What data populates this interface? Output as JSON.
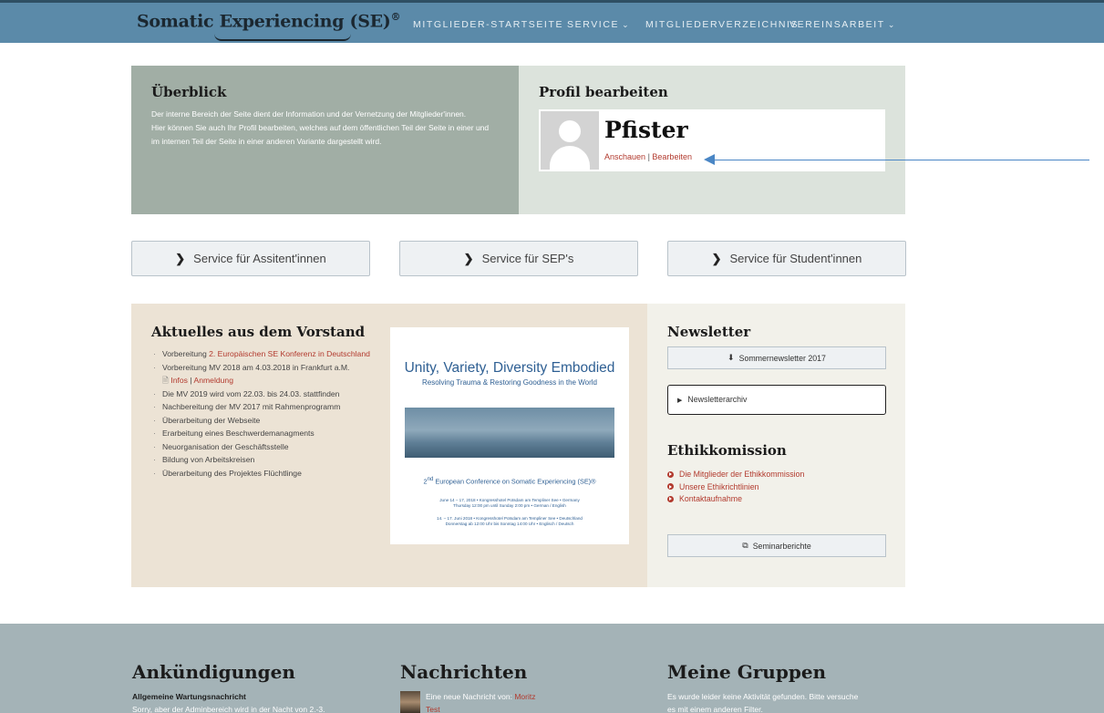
{
  "header": {
    "logo": "Somatic Experiencing (SE)",
    "logo_reg": "®",
    "nav": [
      {
        "label": "MITGLIEDER-STARTSEITE",
        "has_dropdown": false
      },
      {
        "label": "SERVICE",
        "has_dropdown": true
      },
      {
        "label": "MITGLIEDERVERZEICHNIS",
        "has_dropdown": false
      },
      {
        "label": "VEREINSARBEIT",
        "has_dropdown": true
      }
    ],
    "colors": {
      "bar": "#5b8aa9",
      "accent_red": "#b23a2e"
    }
  },
  "overview": {
    "title": "Überblick",
    "text1": "Der interne Bereich der Seite dient der Information und der Vernetzung der Mitglieder'innen.",
    "text2": "Hier können Sie auch Ihr Profil bearbeiten, welches auf dem öffentlichen Teil der Seite in einer und im internen Teil der Seite in einer anderen Variante dargestellt wird."
  },
  "profile": {
    "title": "Profil bearbeiten",
    "name": "Pfister",
    "view_link": "Anschauen",
    "separator": "|",
    "edit_link": "Bearbeiten"
  },
  "services": [
    "Service für Assitent'innen",
    "Service für SEP's",
    "Service für Student'innen"
  ],
  "board": {
    "title": "Aktuelles aus dem Vorstand",
    "item1_prefix": "Vorbereitung ",
    "item1_link": "2. Europäischen SE Konferenz in Deutschland",
    "item2": "Vorbereitung MV 2018 am 4.03.2018 in Frankfurt a.M.",
    "item2_link_infos": "Infos",
    "item2_sep": "|",
    "item2_link_anmeldung": "Anmeldung",
    "items": [
      "Die MV 2019 wird vom 22.03. bis 24.03. stattfinden",
      "Nachbereitung der MV 2017 mit Rahmenprogramm",
      "Überarbeitung der Webseite",
      "Erarbeitung eines Beschwerdemanagments",
      "Neuorganisation der Geschäftsstelle",
      "Bildung von Arbeitskreisen",
      "Überarbeitung des Projektes Flüchtlinge"
    ]
  },
  "poster": {
    "title": "Unity, Variety, Diversity Embodied",
    "subtitle": "Resolving Trauma & Restoring Goodness in the World",
    "conference_prefix": "2",
    "conference_sup": "nd",
    "conference_rest": " European Conference on Somatic Experiencing (SE)®",
    "dates_en_1": "June 14 – 17, 2018 • Kongresshotel Potsdam am Templiner See • Germany",
    "dates_en_2": "Thursday 12:00 pm until Sunday 2:00 pm • German / English",
    "dates_de_1": "14. – 17. Juni 2018 • Kongresshotel Potsdam am Templiner See • Deutschland",
    "dates_de_2": "Donnerstag ab 12:00 Uhr bis Sonntag 14:00 Uhr • Englisch / Deutsch"
  },
  "newsletter": {
    "title": "Newsletter",
    "download_label": "Sommernewsletter 2017",
    "archive_label": "Newsletterarchiv"
  },
  "ethics": {
    "title": "Ethikkomission",
    "links": [
      "Die Mitglieder der Ethikkommission",
      "Unsere Ethikrichtlinien",
      "Kontaktaufnahme"
    ],
    "reports_label": "Seminarberichte"
  },
  "footer": {
    "announcements_title": "Ankündigungen",
    "announcement_heading": "Allgemeine Wartungsnachricht",
    "announcement_text": "Sorry, aber der Adminbereich wird in der Nacht von 2.-3.",
    "messages_title": "Nachrichten",
    "message_prefix": "Eine neue Nachricht von: ",
    "message_sender": "Moritz",
    "message_sender2": "Test",
    "groups_title": "Meine Gruppen",
    "groups_text": "Es wurde leider keine Aktivität gefunden. Bitte versuche",
    "groups_text2": "es mit einem anderen Filter."
  }
}
